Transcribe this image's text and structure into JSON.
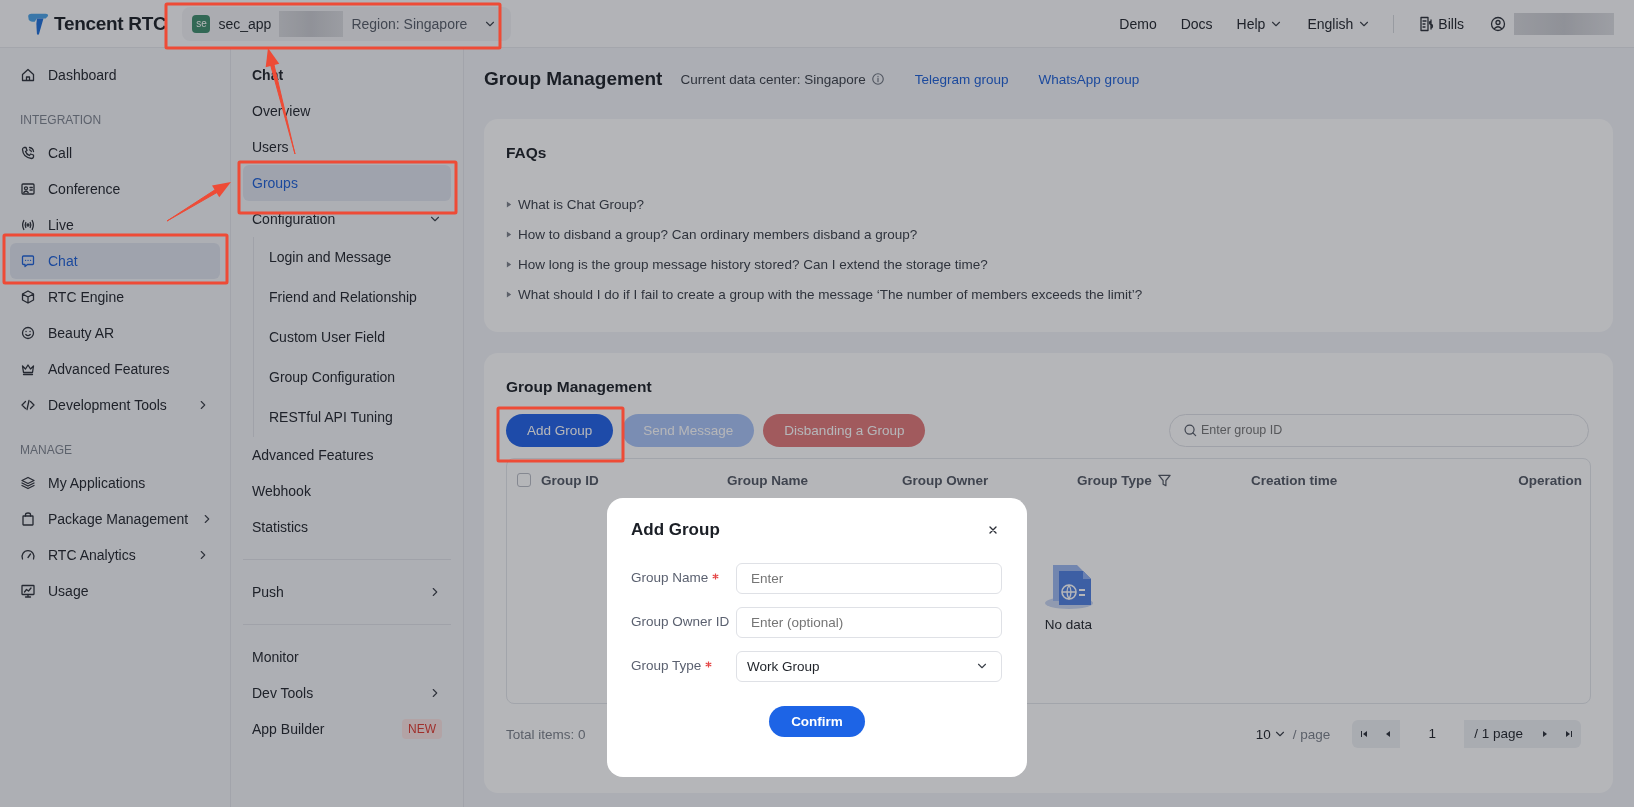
{
  "topbar": {
    "logo_text": "Tencent RTC",
    "app_selector": {
      "badge": "se",
      "name": "sec_app",
      "region": "Region: Singapore"
    },
    "nav": [
      {
        "label": "Demo",
        "has_menu": false
      },
      {
        "label": "Docs",
        "has_menu": false
      },
      {
        "label": "Help",
        "has_menu": true
      },
      {
        "label": "English",
        "has_menu": true
      }
    ],
    "bills": "Bills"
  },
  "sidebar": {
    "items": [
      {
        "kind": "item",
        "label": "Dashboard",
        "selected": false
      },
      {
        "kind": "section",
        "label": "INTEGRATION"
      },
      {
        "kind": "item",
        "label": "Call",
        "selected": false
      },
      {
        "kind": "item",
        "label": "Conference",
        "selected": false
      },
      {
        "kind": "item",
        "label": "Live",
        "selected": false
      },
      {
        "kind": "item",
        "label": "Chat",
        "selected": true
      },
      {
        "kind": "item",
        "label": "RTC Engine",
        "selected": false
      },
      {
        "kind": "item",
        "label": "Beauty AR",
        "selected": false
      },
      {
        "kind": "item",
        "label": "Advanced Features",
        "selected": false
      },
      {
        "kind": "item",
        "label": "Development Tools",
        "selected": false,
        "expanded": false
      },
      {
        "kind": "section",
        "label": "MANAGE"
      },
      {
        "kind": "item",
        "label": "My Applications",
        "selected": false
      },
      {
        "kind": "item",
        "label": "Package Management",
        "selected": false,
        "expanded": false
      },
      {
        "kind": "item",
        "label": "RTC Analytics",
        "selected": false,
        "expanded": false
      },
      {
        "kind": "item",
        "label": "Usage",
        "selected": false
      }
    ]
  },
  "subnav": {
    "title": "Chat",
    "items": [
      {
        "kind": "item",
        "label": "Overview",
        "selected": false
      },
      {
        "kind": "item",
        "label": "Users",
        "selected": false
      },
      {
        "kind": "item",
        "label": "Groups",
        "selected": true
      },
      {
        "kind": "item",
        "label": "Configuration",
        "selected": false,
        "expanded": true,
        "children": [
          {
            "label": "Login and Message",
            "selected": false
          },
          {
            "label": "Friend and Relationship",
            "selected": false
          },
          {
            "label": "Custom User Field",
            "selected": false
          },
          {
            "label": "Group Configuration",
            "selected": false
          },
          {
            "label": "RESTful API Tuning",
            "selected": false
          }
        ]
      },
      {
        "kind": "item",
        "label": "Advanced Features",
        "selected": false
      },
      {
        "kind": "item",
        "label": "Webhook",
        "selected": false
      },
      {
        "kind": "item",
        "label": "Statistics",
        "selected": false
      },
      {
        "kind": "divider"
      },
      {
        "kind": "item",
        "label": "Push",
        "selected": false,
        "expanded": false
      },
      {
        "kind": "divider"
      },
      {
        "kind": "item",
        "label": "Monitor",
        "selected": false
      },
      {
        "kind": "item",
        "label": "Dev Tools",
        "selected": false,
        "expanded": false
      },
      {
        "kind": "item",
        "label": "App Builder",
        "selected": false,
        "badge": "NEW"
      }
    ]
  },
  "header": {
    "title": "Group Management",
    "data_center": "Current data center: Singapore",
    "links": [
      "Telegram group",
      "WhatsApp group"
    ]
  },
  "faq": {
    "title": "FAQs",
    "items": [
      "What is Chat Group?",
      "How to disband a group? Can ordinary members disband a group?",
      "How long is the group message history stored? Can I extend the storage time?",
      "What should I do if I fail to create a group with the message ‘The number of members exceeds the limit’?"
    ]
  },
  "groups": {
    "title": "Group Management",
    "buttons": [
      {
        "label": "Add Group",
        "kind": "primary",
        "disabled": false
      },
      {
        "label": "Send Message",
        "kind": "primary",
        "disabled": true
      },
      {
        "label": "Disbanding a Group",
        "kind": "danger",
        "disabled": true
      }
    ],
    "search": {
      "placeholder": "Enter group ID"
    },
    "table": {
      "select_all": {
        "checked": false
      },
      "columns": [
        {
          "label": "Group ID",
          "filter": false
        },
        {
          "label": "Group Name",
          "filter": false
        },
        {
          "label": "Group Owner",
          "filter": false
        },
        {
          "label": "Group Type",
          "filter": true
        },
        {
          "label": "Creation time",
          "filter": false
        },
        {
          "label": "Operation",
          "filter": false
        }
      ],
      "empty_text": "No data"
    },
    "footer": {
      "total": "Total items: 0",
      "page_size": "10",
      "per_page": "/ page",
      "page": "1",
      "pages": "/ 1 page"
    }
  },
  "modal": {
    "title": "Add Group",
    "fields": [
      {
        "kind": "input",
        "label": "Group Name",
        "required": true,
        "placeholder": "Enter"
      },
      {
        "kind": "input",
        "label": "Group Owner ID",
        "required": false,
        "placeholder": "Enter (optional)"
      },
      {
        "kind": "select",
        "label": "Group Type",
        "required": true,
        "value": "Work Group"
      }
    ],
    "confirm": "Confirm"
  },
  "annotations": [
    {
      "kind": "box"
    },
    {
      "kind": "box"
    },
    {
      "kind": "box"
    },
    {
      "kind": "box"
    },
    {
      "kind": "arrow"
    },
    {
      "kind": "arrow"
    }
  ]
}
